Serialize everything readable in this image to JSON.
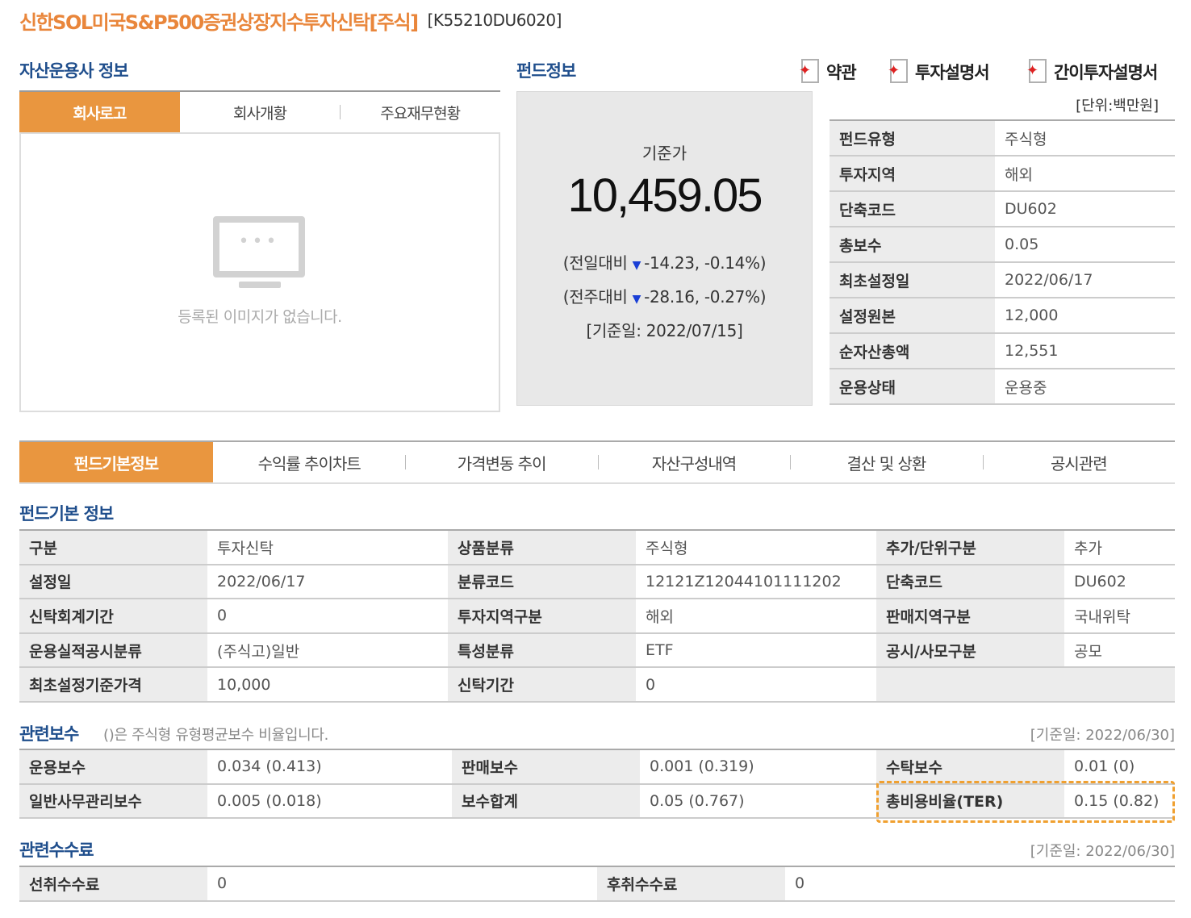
{
  "header": {
    "fund_name": "신한SOL미국S&P500증권상장지수투자신탁[주식]",
    "fund_code": "[K55210DU6020]"
  },
  "company_section": {
    "title": "자산운용사 정보",
    "tabs": [
      "회사로고",
      "회사개황",
      "주요재무현황"
    ],
    "no_image_text": "등록된 이미지가 없습니다."
  },
  "fund_section": {
    "title": "펀드정보",
    "price_label": "기준가",
    "price": "10,459.05",
    "daily_change": {
      "prefix": "(전일대비",
      "value": "-14.23, -0.14%)"
    },
    "weekly_change": {
      "prefix": "(전주대비",
      "value": "-28.16, -0.27%)"
    },
    "base_date": "[기준일: 2022/07/15]"
  },
  "docs": {
    "terms": "약관",
    "prospectus": "투자설명서",
    "simple_prospectus": "간이투자설명서",
    "unit": "[단위:백만원]"
  },
  "fund_info": [
    {
      "key": "펀드유형",
      "value": "주식형"
    },
    {
      "key": "투자지역",
      "value": "해외"
    },
    {
      "key": "단축코드",
      "value": "DU602"
    },
    {
      "key": "총보수",
      "value": "0.05"
    },
    {
      "key": "최초설정일",
      "value": "2022/06/17"
    },
    {
      "key": "설정원본",
      "value": "12,000"
    },
    {
      "key": "순자산총액",
      "value": "12,551"
    },
    {
      "key": "운용상태",
      "value": "운용중"
    }
  ],
  "main_tabs": [
    "펀드기본정보",
    "수익률 추이차트",
    "가격변동 추이",
    "자산구성내역",
    "결산 및 상환",
    "공시관련"
  ],
  "basic_info": {
    "title": "펀드기본 정보",
    "rows": [
      [
        "구분",
        "투자신탁",
        "상품분류",
        "주식형",
        "추가/단위구분",
        "추가"
      ],
      [
        "설정일",
        "2022/06/17",
        "분류코드",
        "12121Z12044101111202",
        "단축코드",
        "DU602"
      ],
      [
        "신탁회계기간",
        "0",
        "투자지역구분",
        "해외",
        "판매지역구분",
        "국내위탁"
      ],
      [
        "운용실적공시분류",
        "(주식고)일반",
        "특성분류",
        "ETF",
        "공시/사모구분",
        "공모"
      ],
      [
        "최초설정기준가격",
        "10,000",
        "신탁기간",
        "0",
        "",
        ""
      ]
    ]
  },
  "fees": {
    "title": "관련보수",
    "note": "()은 주식형 유형평균보수 비율입니다.",
    "base_date": "[기준일: 2022/06/30]",
    "rows": [
      [
        "운용보수",
        "0.034 (0.413)",
        "판매보수",
        "0.001 (0.319)",
        "수탁보수",
        "0.01 (0)"
      ],
      [
        "일반사무관리보수",
        "0.005 (0.018)",
        "보수합계",
        "0.05 (0.767)",
        "총비용비율(TER)",
        "0.15 (0.82)"
      ]
    ]
  },
  "commissions": {
    "title": "관련수수료",
    "base_date": "[기준일: 2022/06/30]",
    "row": [
      "선취수수료",
      "0",
      "후취수수료",
      "0"
    ]
  },
  "colors": {
    "accent_orange": "#e9963f",
    "title_orange": "#e9863b",
    "section_blue": "#1f4e8c",
    "down_blue": "#1a3fd6"
  }
}
